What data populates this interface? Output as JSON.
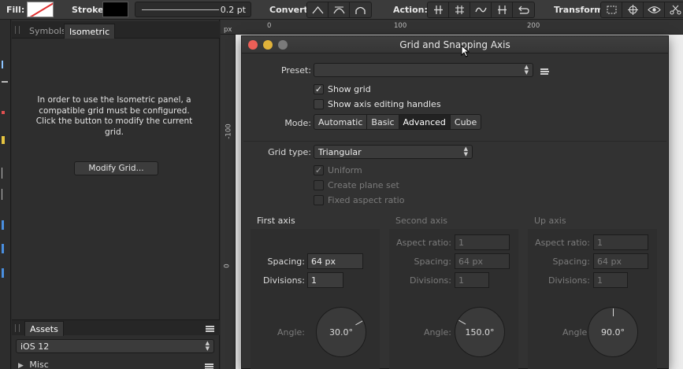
{
  "toolbar": {
    "fill_label": "Fill:",
    "stroke_label": "Stroke",
    "stroke_width": "0.2 pt",
    "convert_label": "Convert:",
    "action_label": "Action:",
    "transform_label": "Transform:",
    "convert_icons": [
      "sharp-node-icon",
      "smooth-node-icon",
      "smart-node-icon"
    ],
    "action_icons": [
      "break-curve-icon",
      "join-curves-icon",
      "smooth-curve-icon",
      "reverse-curve-icon",
      "close-curve-icon"
    ],
    "transform_icons": [
      "transform-bounds-icon",
      "target-icon",
      "eye-icon",
      "scissors-icon"
    ]
  },
  "left_panel": {
    "tabs": [
      "Symbols",
      "Isometric"
    ],
    "active_tab": "Isometric",
    "message": "In order to use the Isometric panel, a compatible grid must be configured. Click the button to modify the current grid.",
    "modify_button": "Modify Grid...",
    "assets_tab": "Assets",
    "assets_select": "iOS 12",
    "misc_label": "Misc"
  },
  "ruler": {
    "unit": "px",
    "top_ticks": [
      "0",
      "100",
      "200"
    ],
    "left_ticks": [
      "-100",
      "0"
    ]
  },
  "dialog": {
    "title": "Grid and Snapping Axis",
    "preset_label": "Preset:",
    "preset_value": "",
    "show_grid_label": "Show grid",
    "show_grid_checked": true,
    "show_axis_label": "Show axis editing handles",
    "show_axis_checked": false,
    "mode_label": "Mode:",
    "modes": [
      "Automatic",
      "Basic",
      "Advanced",
      "Cube"
    ],
    "active_mode": "Advanced",
    "grid_type_label": "Grid type:",
    "grid_type_value": "Triangular",
    "uniform_label": "Uniform",
    "uniform_checked": true,
    "create_plane_label": "Create plane set",
    "fixed_aspect_label": "Fixed aspect ratio",
    "axes": [
      {
        "title": "First axis",
        "enabled": true,
        "aspect_label": "",
        "aspect_value": "",
        "spacing_label": "Spacing:",
        "spacing_value": "64 px",
        "divisions_label": "Divisions:",
        "divisions_value": "1",
        "angle_label": "Angle:",
        "angle_value": "30.0°",
        "angle_deg": 30
      },
      {
        "title": "Second axis",
        "enabled": false,
        "aspect_label": "Aspect ratio:",
        "aspect_value": "1",
        "spacing_label": "Spacing:",
        "spacing_value": "64 px",
        "divisions_label": "Divisions:",
        "divisions_value": "1",
        "angle_label": "Angle:",
        "angle_value": "150.0°",
        "angle_deg": 150
      },
      {
        "title": "Up axis",
        "enabled": false,
        "aspect_label": "Aspect ratio:",
        "aspect_value": "1",
        "spacing_label": "Spacing:",
        "spacing_value": "64 px",
        "divisions_label": "Divisions:",
        "divisions_value": "1",
        "angle_label": "Angle:",
        "angle_value": "90.0°",
        "angle_deg": 90
      }
    ]
  },
  "colors": {
    "close": "#ec5f57",
    "minimize": "#e0b23a",
    "zoom": "#7a7a7a",
    "fill_slash": "#e03030"
  }
}
